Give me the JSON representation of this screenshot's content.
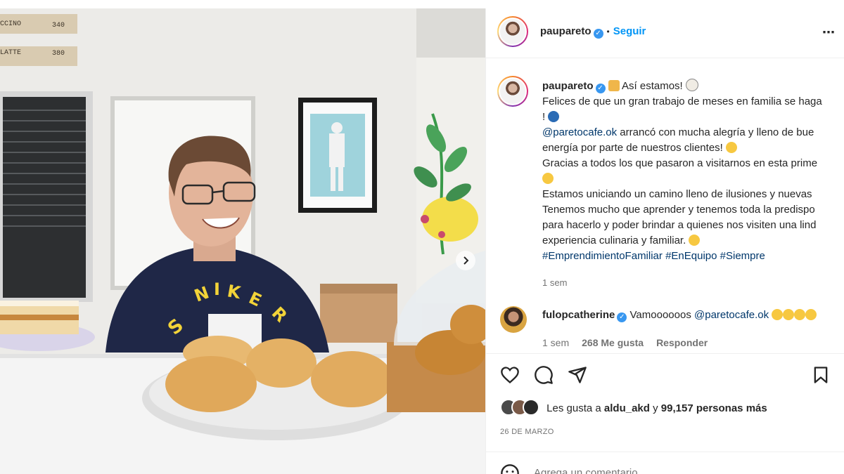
{
  "photo": {
    "menu_board": [
      {
        "item": "CCINO",
        "price": "340"
      },
      {
        "item": "LATTE",
        "price": "380"
      }
    ],
    "sweatshirt_text": "NIKE"
  },
  "header": {
    "username": "paupareto",
    "separator": "•",
    "follow_label": "Seguir"
  },
  "caption": {
    "username": "paupareto",
    "lines": [
      "Así estamos!",
      "Felices de que un gran trabajo de meses en familia se haga",
      "!",
      "arrancó con mucha alegría y lleno de bue",
      "energía por parte de nuestros clientes!",
      "Gracias a todos los que pasaron a visitarnos en esta prime",
      "Estamos uniciando un camino lleno de ilusiones y nuevas",
      "Tenemos mucho que aprender y tenemos toda la predispo",
      "para hacerlo y poder brindar a quienes nos visiten una lind",
      "experiencia culinaria y familiar."
    ],
    "mention": "@paretocafe.ok",
    "hashtags": [
      "#EmprendimientoFamiliar",
      "#EnEquipo",
      "#Siempre"
    ],
    "time": "1 sem"
  },
  "comment": {
    "username": "fulopcatherine",
    "text": "Vamoooooos",
    "mention": "@paretocafe.ok",
    "time": "1 sem",
    "likes": "268 Me gusta",
    "reply_label": "Responder"
  },
  "likes": {
    "prefix": "Les gusta a",
    "user": "aldu_akd",
    "conj": "y",
    "others": "99,157 personas más"
  },
  "date": "26 DE MARZO",
  "add_comment": {
    "placeholder": "Agrega un comentario..."
  },
  "colors": {
    "follow": "#0095f6",
    "link": "#00376b",
    "verified": "#3897f0",
    "sweatshirt": "#1f2747",
    "nike_letters": "#f2d338"
  }
}
